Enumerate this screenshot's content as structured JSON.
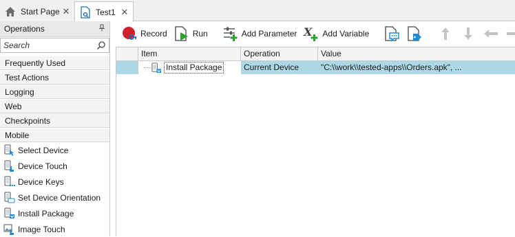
{
  "tabs": [
    {
      "label": "Start Page",
      "icon": "home-icon",
      "close": "✕"
    },
    {
      "label": "Test1",
      "icon": "test-icon",
      "close": "✕"
    }
  ],
  "operations_panel": {
    "title": "Operations",
    "search_placeholder": "Search",
    "categories": [
      "Frequently Used",
      "Test Actions",
      "Logging",
      "Web",
      "Checkpoints",
      "Mobile"
    ],
    "mobile_operations": [
      {
        "label": "Select Device",
        "icon": "device-pointer-icon"
      },
      {
        "label": "Device Touch",
        "icon": "device-touch-icon"
      },
      {
        "label": "Device Keys",
        "icon": "device-keys-icon"
      },
      {
        "label": "Set Device Orientation",
        "icon": "device-orientation-icon"
      },
      {
        "label": "Install Package",
        "icon": "install-package-icon"
      },
      {
        "label": "Image Touch",
        "icon": "image-touch-icon"
      }
    ]
  },
  "toolbar": {
    "record_label": "Record",
    "run_label": "Run",
    "add_parameter_label": "Add Parameter",
    "add_variable_label": "Add Variable"
  },
  "grid": {
    "columns": [
      "Item",
      "Operation",
      "Value"
    ],
    "rows": [
      {
        "item": "Install Package",
        "operation": "Current Device",
        "value": "\"C:\\\\work\\\\tested-apps\\\\Orders.apk\", ..."
      }
    ]
  },
  "colors": {
    "selection": "#add8e6",
    "record_red": "#d21f2e",
    "run_green": "#2aa32a",
    "accent_blue": "#1e8bd6"
  }
}
